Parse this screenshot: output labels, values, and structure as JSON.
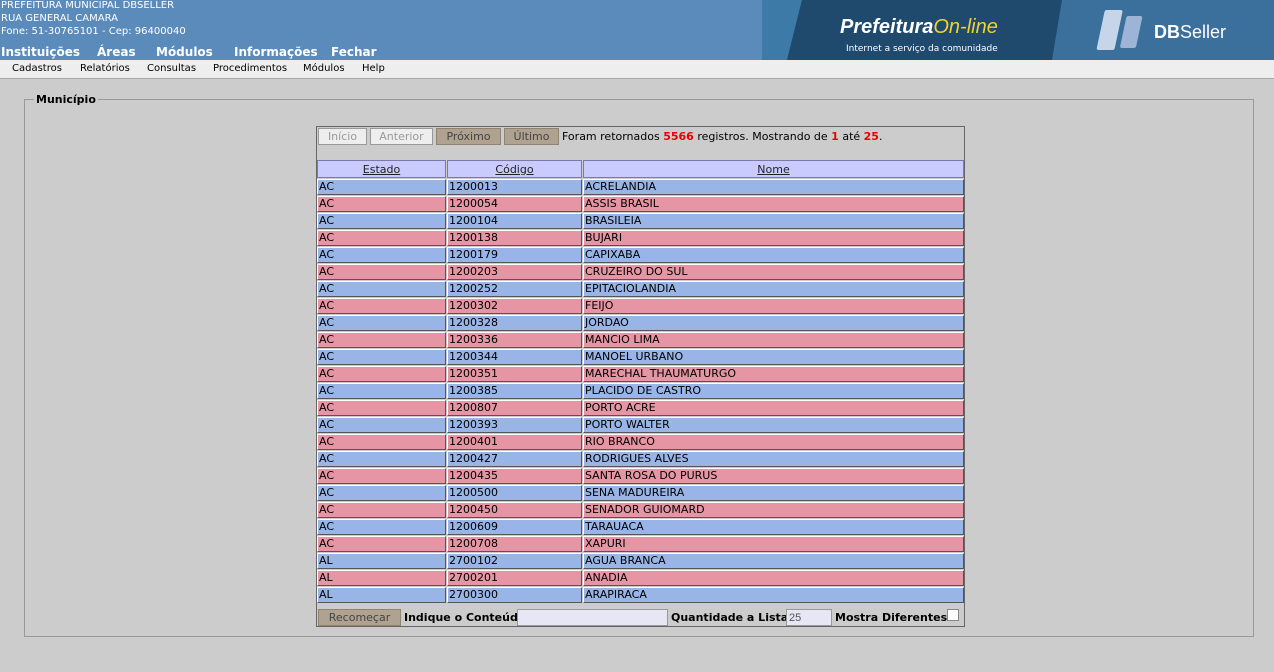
{
  "header": {
    "org_name": "PREFEITURA MUNICIPAL DBSELLER",
    "address": "RUA GENERAL CAMARA",
    "contact": "Fone: 51-30765101  -  Cep: 96400040",
    "main_menu": [
      "Instituições",
      "Áreas",
      "Módulos",
      "Informações",
      "Fechar"
    ],
    "banner_title_part1": "Prefeitura",
    "banner_title_part2": "On-line",
    "banner_tagline": "Internet a serviço da comunidade",
    "banner_brand_bold": "DB",
    "banner_brand_light": "Seller"
  },
  "sub_menu": [
    "Cadastros",
    "Relatórios",
    "Consultas",
    "Procedimentos",
    "Módulos",
    "Help"
  ],
  "fieldset_legend": "Município",
  "pagination": {
    "buttons": [
      "Início",
      "Anterior",
      "Próximo",
      "Último"
    ],
    "status_prefix": "Foram retornados",
    "total": "5566",
    "status_middle": "registros. Mostrando de",
    "from": "1",
    "status_to": "até",
    "to": "25",
    "status_suffix": "."
  },
  "table": {
    "columns": [
      "Estado",
      "Código",
      "Nome"
    ],
    "rows": [
      [
        "AC",
        "1200013",
        "ACRELANDIA"
      ],
      [
        "AC",
        "1200054",
        "ASSIS BRASIL"
      ],
      [
        "AC",
        "1200104",
        "BRASILEIA"
      ],
      [
        "AC",
        "1200138",
        "BUJARI"
      ],
      [
        "AC",
        "1200179",
        "CAPIXABA"
      ],
      [
        "AC",
        "1200203",
        "CRUZEIRO DO SUL"
      ],
      [
        "AC",
        "1200252",
        "EPITACIOLANDIA"
      ],
      [
        "AC",
        "1200302",
        "FEIJO"
      ],
      [
        "AC",
        "1200328",
        "JORDAO"
      ],
      [
        "AC",
        "1200336",
        "MANCIO LIMA"
      ],
      [
        "AC",
        "1200344",
        "MANOEL URBANO"
      ],
      [
        "AC",
        "1200351",
        "MARECHAL THAUMATURGO"
      ],
      [
        "AC",
        "1200385",
        "PLACIDO DE CASTRO"
      ],
      [
        "AC",
        "1200807",
        "PORTO ACRE"
      ],
      [
        "AC",
        "1200393",
        "PORTO WALTER"
      ],
      [
        "AC",
        "1200401",
        "RIO BRANCO"
      ],
      [
        "AC",
        "1200427",
        "RODRIGUES ALVES"
      ],
      [
        "AC",
        "1200435",
        "SANTA ROSA DO PURUS"
      ],
      [
        "AC",
        "1200500",
        "SENA MADUREIRA"
      ],
      [
        "AC",
        "1200450",
        "SENADOR GUIOMARD"
      ],
      [
        "AC",
        "1200609",
        "TARAUACA"
      ],
      [
        "AC",
        "1200708",
        "XAPURI"
      ],
      [
        "AL",
        "2700102",
        "AGUA BRANCA"
      ],
      [
        "AL",
        "2700201",
        "ANADIA"
      ],
      [
        "AL",
        "2700300",
        "ARAPIRACA"
      ]
    ]
  },
  "footer": {
    "restart_label": "Recomeçar",
    "content_label": "Indique o Conteúdo:",
    "content_value": "",
    "qty_label": "Quantidade a Listar:",
    "qty_value": "25",
    "distinct_label": "Mostra Diferentes:",
    "distinct_checked": false
  },
  "colors": {
    "header_bg": "#5b8bbb",
    "row_blue": "#99b4e6",
    "row_pink": "#e695a4",
    "column_header_bg": "#c9cbff",
    "highlight_number": "#e00000",
    "banner_accent": "#f2d031"
  }
}
